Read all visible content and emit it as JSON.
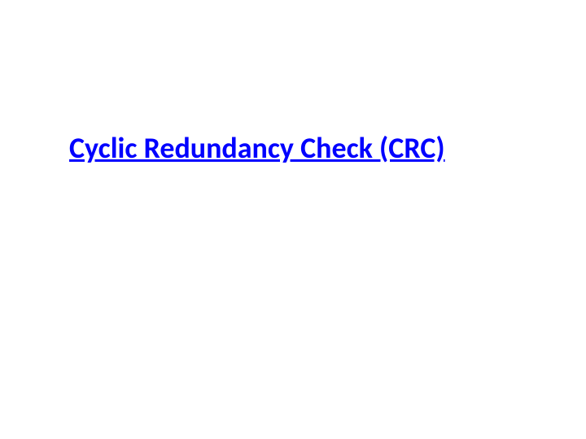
{
  "slide": {
    "title": "Cyclic Redundancy Check (CRC)"
  }
}
